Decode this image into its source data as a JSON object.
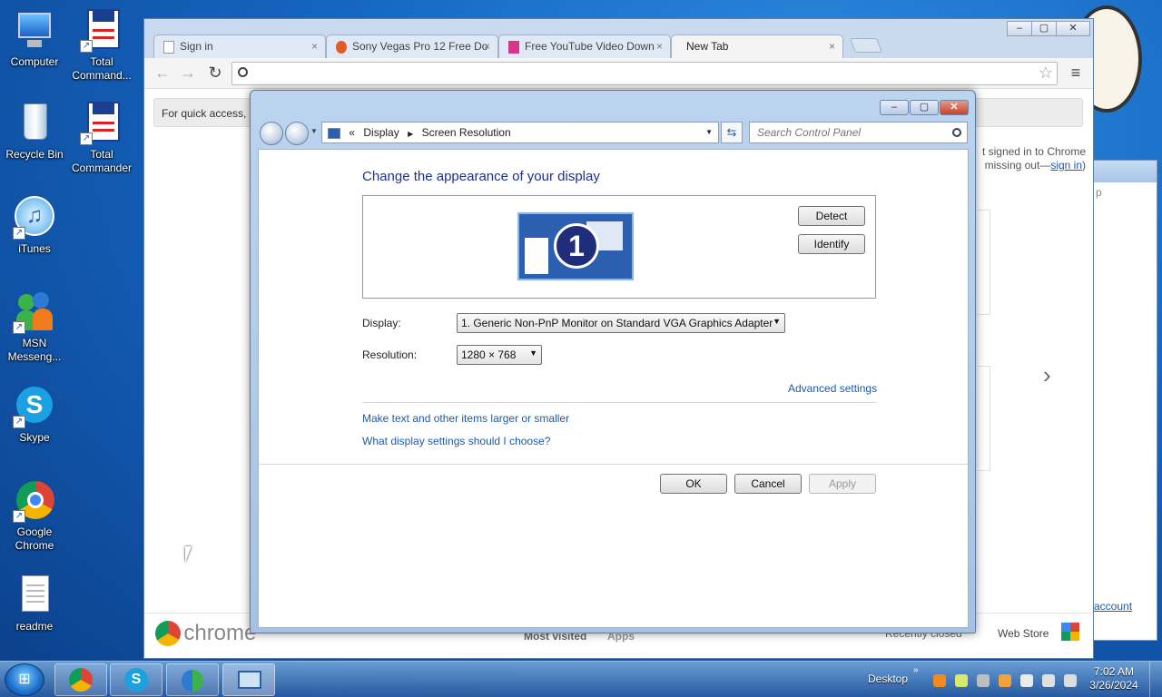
{
  "desktop": {
    "icons": [
      {
        "label": "Computer"
      },
      {
        "label": "Total Command..."
      },
      {
        "label": "Recycle Bin"
      },
      {
        "label": "Total Commander"
      },
      {
        "label": "iTunes"
      },
      {
        "label": "MSN Messeng..."
      },
      {
        "label": "Skype"
      },
      {
        "label": "Google Chrome"
      },
      {
        "label": "readme"
      }
    ]
  },
  "browser": {
    "tabs": [
      {
        "label": "Sign in"
      },
      {
        "label": "Sony Vegas Pro 12 Free Do"
      },
      {
        "label": "Free YouTube Video Down"
      },
      {
        "label": "New Tab"
      }
    ],
    "tab_close_glyph": "×",
    "infobar_text": "For quick access, p",
    "signin_note_line1": "t signed in to Chrome",
    "signin_note_line2": "missing out—",
    "signin_link": "sign in",
    "signin_close_paren": ")",
    "logo_text": "chrome",
    "bottom_links": [
      "Most visited",
      "Apps"
    ],
    "recently_closed": "Recently closed",
    "web_store": "Web Store",
    "next_arrow": "›",
    "side_text": "p",
    "side_link": "account"
  },
  "dialog": {
    "breadcrumb_root": "«",
    "breadcrumb": [
      "Display",
      "Screen Resolution"
    ],
    "search_placeholder": "Search Control Panel",
    "heading": "Change the appearance of your display",
    "monitor_number": "1",
    "detect_label": "Detect",
    "identify_label": "Identify",
    "display_label": "Display:",
    "display_value": "1. Generic Non-PnP Monitor on Standard VGA Graphics Adapter",
    "resolution_label": "Resolution:",
    "resolution_value": "1280 × 768",
    "advanced_link": "Advanced settings",
    "link_text_size": "Make text and other items larger or smaller",
    "link_help": "What display settings should I choose?",
    "ok_label": "OK",
    "cancel_label": "Cancel",
    "apply_label": "Apply"
  },
  "taskbar": {
    "desktop_label": "Desktop",
    "time": "7:02 AM",
    "date": "3/26/2024"
  },
  "colors": {
    "heading": "#1e3287",
    "link": "#1e5aa8",
    "desktop": "#1565c0"
  }
}
